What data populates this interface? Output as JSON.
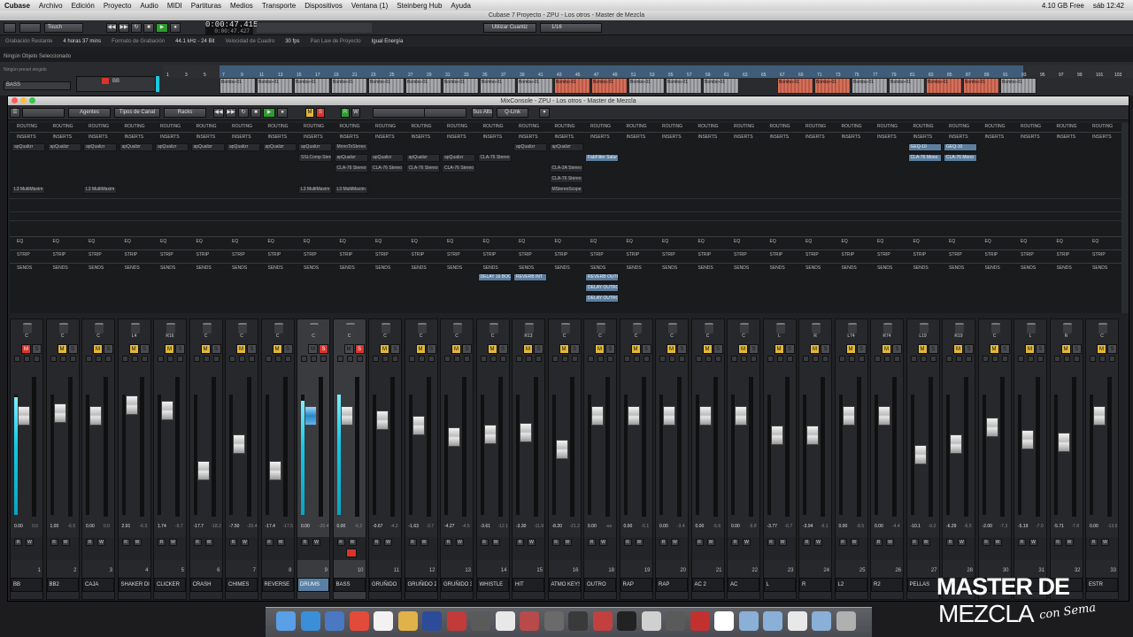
{
  "menubar": {
    "items": [
      "Cubase",
      "Archivo",
      "Edición",
      "Proyecto",
      "Audio",
      "MIDI",
      "Partituras",
      "Medios",
      "Transporte",
      "Dispositivos",
      "Ventana (1)",
      "Steinberg Hub",
      "Ayuda"
    ],
    "right": [
      "4.10 GB Free",
      "sáb 12:42"
    ]
  },
  "project_window": {
    "title": "Cubase 7 Proyecto - ZPU - Los otros - Master de Mezcla",
    "mode": "Touch",
    "time_primary": "0:00:47.415",
    "time_secondary": "0:00:47.427",
    "quantize_label": "Utilizar Cuantiz",
    "quantize_value": "1/16"
  },
  "status_line": [
    {
      "label": "Grabación Restante",
      "value": "4 horas 37 mins"
    },
    {
      "label": "Formato de Grabación",
      "value": "44.1 kHz - 24 Bit"
    },
    {
      "label": "Velocidad de Cuadro",
      "value": "30 fps"
    },
    {
      "label": "Pan Law de Proyecto",
      "value": "Igual Energía"
    }
  ],
  "no_selection": "Ningún Objeto Seleccionado",
  "track_header": {
    "preset": "Ningún preset elegido",
    "track": "BASS",
    "sub": "BB"
  },
  "ruler": [
    "1",
    "3",
    "5",
    "7",
    "9",
    "11",
    "13",
    "15",
    "17",
    "19",
    "21",
    "23",
    "25",
    "27",
    "29",
    "31",
    "33",
    "35",
    "37",
    "39",
    "41",
    "43",
    "45",
    "47",
    "49",
    "51",
    "53",
    "55",
    "57",
    "59",
    "61",
    "63",
    "65",
    "67",
    "69",
    "71",
    "73",
    "75",
    "77",
    "79",
    "81",
    "83",
    "85",
    "87",
    "89",
    "91",
    "93",
    "95",
    "97",
    "99",
    "101",
    "103"
  ],
  "clip_label": "Bombo-01",
  "mixconsole": {
    "title": "MixConsole - ZPU - Los otros - Master de Mezcla",
    "toolbar": {
      "agentes": "Agentes",
      "tipos": "Tipos de Canal",
      "racks": "Racks",
      "sus_alts": "Sus Alts",
      "qlink": "Q-Link"
    },
    "section_labels": {
      "routing": "ROUTING",
      "inserts": "INSERTS",
      "eq": "EQ",
      "strip": "STRIP",
      "sends": "SENDS"
    }
  },
  "channels": [
    {
      "num": "1",
      "name": "BB",
      "pan": "C",
      "val": "0.00",
      "val2": "0.0",
      "mute": false,
      "solo": false,
      "red_mute": true,
      "fader_level": 0.72,
      "meter": 0.98
    },
    {
      "num": "2",
      "name": "BB2",
      "pan": "C",
      "val": "1.00",
      "val2": "-6.5",
      "mute": true,
      "solo": false,
      "fader_level": 0.74,
      "meter": 0
    },
    {
      "num": "3",
      "name": "CAJA",
      "pan": "C",
      "val": "0.00",
      "val2": "0.0",
      "mute": true,
      "solo": false,
      "fader_level": 0.72,
      "meter": 0
    },
    {
      "num": "4",
      "name": "SHAKER DIST",
      "pan": "L4",
      "val": "2.91",
      "val2": "-6.3",
      "mute": true,
      "solo": false,
      "fader_level": 0.8,
      "meter": 0
    },
    {
      "num": "5",
      "name": "CLICKER",
      "pan": "R16",
      "val": "1.74",
      "val2": "-9.7",
      "mute": true,
      "solo": false,
      "fader_level": 0.76,
      "meter": 0
    },
    {
      "num": "6",
      "name": "CRASH",
      "pan": "C",
      "val": "-17.7",
      "val2": "-18.2",
      "mute": true,
      "solo": false,
      "fader_level": 0.33,
      "meter": 0
    },
    {
      "num": "7",
      "name": "CHIMES",
      "pan": "C",
      "val": "-7.50",
      "val2": "-20.4",
      "mute": true,
      "solo": false,
      "fader_level": 0.52,
      "meter": 0
    },
    {
      "num": "8",
      "name": "REVERSE",
      "pan": "C",
      "val": "-17.4",
      "val2": "-17.5",
      "mute": true,
      "solo": false,
      "fader_level": 0.33,
      "meter": 0
    },
    {
      "num": "9",
      "name": "DRUMS",
      "pan": "C",
      "val": "0.00",
      "val2": "-20.4",
      "mute": false,
      "solo": true,
      "fader_level": 0.72,
      "meter": 0.95,
      "blue": true,
      "sel": true
    },
    {
      "num": "10",
      "name": "BASS",
      "pan": "C",
      "val": "0.00",
      "val2": "-6.2",
      "mute": false,
      "solo": true,
      "fader_level": 0.72,
      "meter": 1.0,
      "sel": true
    },
    {
      "num": "11",
      "name": "GRUÑIDO",
      "pan": "C",
      "val": "-0.67",
      "val2": "-4.2",
      "mute": true,
      "solo": false,
      "fader_level": 0.69,
      "meter": 0
    },
    {
      "num": "12",
      "name": "GRUÑIDO 2",
      "pan": "C",
      "val": "-1.63",
      "val2": "-3.7",
      "mute": true,
      "solo": false,
      "fader_level": 0.65,
      "meter": 0
    },
    {
      "num": "13",
      "name": "GRUÑIDO 3",
      "pan": "C",
      "val": "-4.27",
      "val2": "-4.5",
      "mute": true,
      "solo": false,
      "fader_level": 0.57,
      "meter": 0
    },
    {
      "num": "14",
      "name": "WHISTLE",
      "pan": "C",
      "val": "-3.61",
      "val2": "-12.1",
      "mute": true,
      "solo": false,
      "fader_level": 0.59,
      "meter": 0
    },
    {
      "num": "15",
      "name": "HIT",
      "pan": "R13",
      "val": "-3.30",
      "val2": "-11.9",
      "mute": true,
      "solo": false,
      "fader_level": 0.6,
      "meter": 0
    },
    {
      "num": "16",
      "name": "ATMO KEYS",
      "pan": "C",
      "val": "-8.20",
      "val2": "-21.2",
      "mute": true,
      "solo": false,
      "fader_level": 0.48,
      "meter": 0
    },
    {
      "num": "18",
      "name": "OUTRO",
      "pan": "C",
      "val": "0.00",
      "val2": "-oo",
      "mute": true,
      "solo": false,
      "fader_level": 0.72,
      "meter": 0
    },
    {
      "num": "19",
      "name": "RAP",
      "pan": "C",
      "val": "0.00",
      "val2": "-5.1",
      "mute": true,
      "solo": false,
      "fader_level": 0.72,
      "meter": 0
    },
    {
      "num": "20",
      "name": "RAP",
      "pan": "C",
      "val": "0.00",
      "val2": "-3.4",
      "mute": true,
      "solo": false,
      "fader_level": 0.72,
      "meter": 0
    },
    {
      "num": "21",
      "name": "AC 2",
      "pan": "C",
      "val": "0.00",
      "val2": "-5.6",
      "mute": true,
      "solo": false,
      "fader_level": 0.72,
      "meter": 0
    },
    {
      "num": "22",
      "name": "AC",
      "pan": "C",
      "val": "0.00",
      "val2": "-6.8",
      "mute": true,
      "solo": false,
      "fader_level": 0.72,
      "meter": 0
    },
    {
      "num": "23",
      "name": "L",
      "pan": "L",
      "val": "-3.77",
      "val2": "-6.7",
      "mute": true,
      "solo": false,
      "fader_level": 0.58,
      "meter": 0
    },
    {
      "num": "24",
      "name": "R",
      "pan": "R",
      "val": "-3.94",
      "val2": "-6.1",
      "mute": true,
      "solo": false,
      "fader_level": 0.58,
      "meter": 0
    },
    {
      "num": "25",
      "name": "L2",
      "pan": "L74",
      "val": "0.00",
      "val2": "-8.5",
      "mute": true,
      "solo": false,
      "fader_level": 0.72,
      "meter": 0
    },
    {
      "num": "26",
      "name": "R2",
      "pan": "R74",
      "val": "0.00",
      "val2": "-4.4",
      "mute": true,
      "solo": false,
      "fader_level": 0.72,
      "meter": 0
    },
    {
      "num": "27",
      "name": "PELLAS",
      "pan": "L19",
      "val": "-10.1",
      "val2": "-9.3",
      "mute": true,
      "solo": false,
      "fader_level": 0.44,
      "meter": 0
    },
    {
      "num": "28",
      "name": "",
      "pan": "R19",
      "val": "-6.29",
      "val2": "-6.5",
      "mute": true,
      "solo": false,
      "fader_level": 0.52,
      "meter": 0
    },
    {
      "num": "30",
      "name": "",
      "pan": "C",
      "val": "-2.00",
      "val2": "-7.3",
      "mute": true,
      "solo": false,
      "fader_level": 0.64,
      "meter": 0
    },
    {
      "num": "31",
      "name": "",
      "pan": "L",
      "val": "-5.19",
      "val2": "-7.0",
      "mute": true,
      "solo": false,
      "fader_level": 0.55,
      "meter": 0
    },
    {
      "num": "32",
      "name": "",
      "pan": "R",
      "val": "-5.71",
      "val2": "-7.8",
      "mute": true,
      "solo": false,
      "fader_level": 0.53,
      "meter": 0
    },
    {
      "num": "33",
      "name": "ESTR",
      "pan": "C",
      "val": "0.00",
      "val2": "-13.6",
      "mute": true,
      "solo": false,
      "fader_level": 0.72,
      "meter": 0
    }
  ],
  "inserts": [
    {
      "ch": 0,
      "row": 0,
      "text": "apQualizr"
    },
    {
      "ch": 1,
      "row": 0,
      "text": "apQualizr"
    },
    {
      "ch": 2,
      "row": 0,
      "text": "apQualizr"
    },
    {
      "ch": 3,
      "row": 0,
      "text": "apQualizr"
    },
    {
      "ch": 4,
      "row": 0,
      "text": "apQualizr"
    },
    {
      "ch": 5,
      "row": 0,
      "text": "apQualizr"
    },
    {
      "ch": 6,
      "row": 0,
      "text": "apQualizr"
    },
    {
      "ch": 7,
      "row": 0,
      "text": "apQualizr"
    },
    {
      "ch": 8,
      "row": 0,
      "text": "apQualizr"
    },
    {
      "ch": 9,
      "row": 0,
      "text": "MonoToStereo"
    },
    {
      "ch": 14,
      "row": 0,
      "text": "apQualizr"
    },
    {
      "ch": 15,
      "row": 0,
      "text": "apQualizr"
    },
    {
      "ch": 8,
      "row": 1,
      "text": "SSLComp Stereo"
    },
    {
      "ch": 9,
      "row": 1,
      "text": "apQualizr"
    },
    {
      "ch": 10,
      "row": 1,
      "text": "apQualizr"
    },
    {
      "ch": 11,
      "row": 1,
      "text": "apQualizr"
    },
    {
      "ch": 12,
      "row": 1,
      "text": "apQualizr"
    },
    {
      "ch": 13,
      "row": 1,
      "text": "CLA-76 Stereo"
    },
    {
      "ch": 9,
      "row": 2,
      "text": "CLA-76 Stereo"
    },
    {
      "ch": 10,
      "row": 2,
      "text": "CLA-76 Stereo"
    },
    {
      "ch": 11,
      "row": 2,
      "text": "CLA-76 Stereo"
    },
    {
      "ch": 12,
      "row": 2,
      "text": "CLA-76 Stereo"
    },
    {
      "ch": 15,
      "row": 2,
      "text": "CLA-2A Stereo"
    },
    {
      "ch": 15,
      "row": 3,
      "text": "CLA-76 Stereo"
    },
    {
      "ch": 15,
      "row": 4,
      "text": "MStereoScope"
    },
    {
      "ch": 0,
      "row": 4,
      "text": "L3 MultiMaxim"
    },
    {
      "ch": 2,
      "row": 4,
      "text": "L3 MultiMaxim"
    },
    {
      "ch": 8,
      "row": 4,
      "text": "L3 MultiMaxim"
    },
    {
      "ch": 9,
      "row": 4,
      "text": "L3 MultiMaxim"
    },
    {
      "ch": 16,
      "row": 1,
      "text": "FabFilter Satur",
      "hl": true
    },
    {
      "ch": 25,
      "row": 0,
      "text": "GEQ-10",
      "hl": true
    },
    {
      "ch": 26,
      "row": 0,
      "text": "GEQ-10",
      "hl": true
    },
    {
      "ch": 25,
      "row": 1,
      "text": "CLA-76 Mono",
      "hl": true
    },
    {
      "ch": 26,
      "row": 1,
      "text": "CLA-76 Mono",
      "hl": true
    }
  ],
  "sends": [
    {
      "ch": 13,
      "row": 0,
      "text": "DELAY 16 BOO",
      "hl": true
    },
    {
      "ch": 14,
      "row": 0,
      "text": "REVERB INT",
      "hl": true
    },
    {
      "ch": 16,
      "row": 0,
      "text": "REVERB OUTRO",
      "hl": true
    },
    {
      "ch": 16,
      "row": 1,
      "text": "DELAY OUTRO",
      "hl": true
    },
    {
      "ch": 16,
      "row": 2,
      "text": "DELAY OUTRO",
      "hl": true
    }
  ],
  "watermark": {
    "line1": "MASTER DE",
    "line2": "MEZCLA",
    "script": "con Sema"
  },
  "dock_icons": [
    "finder-icon",
    "safari-icon",
    "mail-icon",
    "chrome-icon",
    "calendar-icon",
    "folder-icon",
    "photoshop-icon",
    "tool-icon",
    "font-icon",
    "script-icon",
    "wine-icon",
    "tools-icon",
    "finalcut-icon",
    "filezilla-icon",
    "cubase-icon",
    "gear-icon",
    "unity-icon",
    "parallels-icon",
    "game-icon",
    "folder-icon",
    "folder-icon",
    "document-icon",
    "downloads-icon",
    "trash-icon"
  ]
}
